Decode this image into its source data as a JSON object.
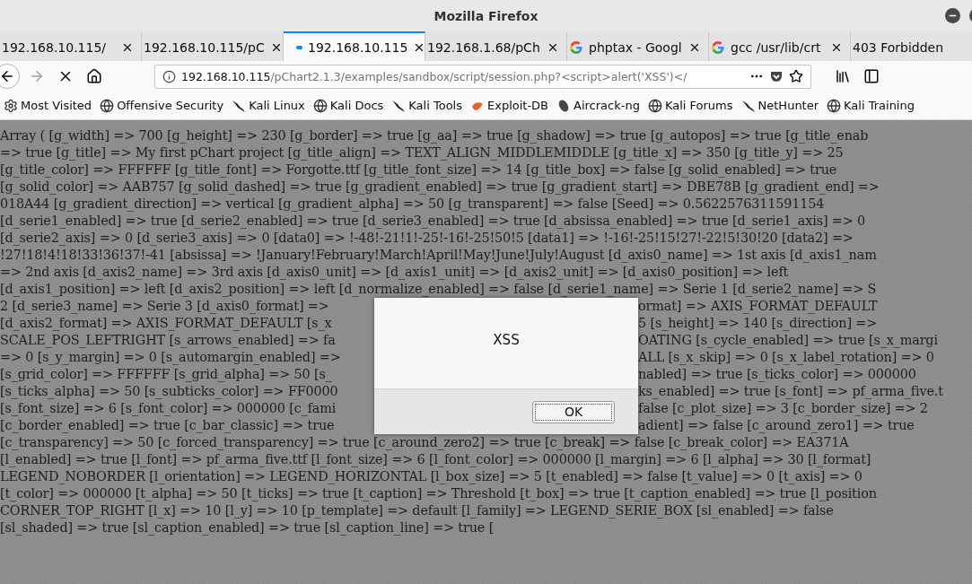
{
  "window": {
    "title": "Mozilla Firefox"
  },
  "tabs": [
    {
      "label": "192.168.10.115/",
      "selected": false,
      "loading": false,
      "kind": "plain"
    },
    {
      "label": "192.168.10.115/pC",
      "selected": false,
      "loading": false,
      "kind": "plain"
    },
    {
      "label": "192.168.10.115",
      "selected": true,
      "loading": true,
      "kind": "plain"
    },
    {
      "label": "192.168.1.68/pCh",
      "selected": false,
      "loading": false,
      "kind": "plain"
    },
    {
      "label": "phptax - Googl",
      "selected": false,
      "loading": false,
      "kind": "google"
    },
    {
      "label": "gcc /usr/lib/crt",
      "selected": false,
      "loading": false,
      "kind": "google"
    },
    {
      "label": "403 Forbidden",
      "selected": false,
      "loading": false,
      "kind": "plain"
    }
  ],
  "address": {
    "host": "192.168.10.115",
    "path": "/pChart2.1.3/examples/sandbox/script/session.php?<script>alert('XSS')</"
  },
  "bookmarks": [
    {
      "label": "Most Visited",
      "kind": "gear"
    },
    {
      "label": "Offensive Security",
      "kind": "globe"
    },
    {
      "label": "Kali Linux",
      "kind": "kali"
    },
    {
      "label": "Kali Docs",
      "kind": "globe"
    },
    {
      "label": "Kali Tools",
      "kind": "kali"
    },
    {
      "label": "Exploit-DB",
      "kind": "exploit"
    },
    {
      "label": "Aircrack-ng",
      "kind": "aircrack"
    },
    {
      "label": "Kali Forums",
      "kind": "globe"
    },
    {
      "label": "NetHunter",
      "kind": "kali"
    },
    {
      "label": "Kali Training",
      "kind": "globe"
    }
  ],
  "page": {
    "lines": [
      {
        "text": "Array ( [g_width] => 700 [g_height] => 230 [g_border] => true [g_aa] => true [g_shadow] => true [g_autopos] => true [g_title_enab"
      },
      {
        "text": "=> true [g_title] => My first pChart project [g_title_align] => TEXT_ALIGN_MIDDLEMIDDLE [g_title_x] => 350 [g_title_y] => 25"
      },
      {
        "text": "[g_title_color] => FFFFFF [g_title_font] => Forgotte.ttf [g_title_font_size] => 14 [g_title_box] => false [g_solid_enabled] => true"
      },
      {
        "text": "[g_solid_color] => AAB757 [g_solid_dashed] => true [g_gradient_enabled] => true [g_gradient_start] => DBE78B [g_gradient_end] =>"
      },
      {
        "text": "018A44 [g_gradient_direction] => vertical [g_gradient_alpha] => 50 [g_transparent] => false [Seed] => 0.5622576311591154"
      },
      {
        "text": "[d_serie1_enabled] => true [d_serie2_enabled] => true [d_serie3_enabled] => true [d_absissa_enabled] => true [d_serie1_axis] => 0"
      },
      {
        "text": "[d_serie2_axis] => 0 [d_serie3_axis] => 0 [data0] => !-48!-21!1!-25!-16!-25!50!5 [data1] => !-16!-25!15!27!-22!5!30!20 [data2] =>"
      },
      {
        "text": "!27!18!4!18!33!36!37!-41 [absissa] => !January!February!March!April!May!June!July!August [d_axis0_name] => 1st axis [d_axis1_nam"
      },
      {
        "text": "=> 2nd axis [d_axis2_name] => 3rd axis [d_axis0_unit] => [d_axis1_unit] => [d_axis2_unit] => [d_axis0_position] => left"
      },
      {
        "text": "[d_axis1_position] => left [d_axis2_position] => left [d_normalize_enabled] => false [d_serie1_name] => Serie 1 [d_serie2_name] => S"
      },
      {
        "left": "2 [d_serie3_name] => Serie 3 [d_axis0_format] =>",
        "right": "ormat] => AXIS_FORMAT_DEFAULT"
      },
      {
        "left": "[d_axis2_format] => AXIS_FORMAT_DEFAULT [s_x",
        "right": "5 [s_height] => 140 [s_direction] =>"
      },
      {
        "left": "SCALE_POS_LEFTRIGHT [s_arrows_enabled] => fa",
        "right": "OATING [s_cycle_enabled] => true [s_x_margi"
      },
      {
        "left": "=> 0 [s_y_margin] => 0 [s_automargin_enabled] =>",
        "right": "ALL [s_x_skip] => 0 [s_x_label_rotation] => 0"
      },
      {
        "left": "[s_grid_color] => FFFFFF [s_grid_alpha] => 50 [s_",
        "right": "nabled] => true [s_ticks_color] => 000000"
      },
      {
        "left": "[s_ticks_alpha] => 50 [s_subticks_color] => FF0000",
        "right": "ks_enabled] => true [s_font] => pf_arma_five.t"
      },
      {
        "left": "[s_font_size] => 6 [s_font_color] => 000000 [c_fami",
        "right": "false [c_plot_size] => 3 [c_border_size] => 2"
      },
      {
        "left": "[c_border_enabled] => true [c_bar_classic] => true",
        "right": "adient] => false [c_around_zero1] => true"
      },
      {
        "text": "[c_transparency] => 50 [c_forced_transparency] => true [c_around_zero2] => true [c_break] => false [c_break_color] => EA371A"
      },
      {
        "text": "[l_enabled] => true [l_font] => pf_arma_five.ttf [l_font_size] => 6 [l_font_color] => 000000 [l_margin] => 6 [l_alpha] => 30 [l_format]"
      },
      {
        "text": "LEGEND_NOBORDER [l_orientation] => LEGEND_HORIZONTAL [l_box_size] => 5 [t_enabled] => false [t_value] => 0 [t_axis] => 0"
      },
      {
        "text": "[t_color] => 000000 [t_alpha] => 50 [t_ticks] => true [t_caption] => Threshold [t_box] => true [t_caption_enabled] => true [l_position"
      },
      {
        "text": "CORNER_TOP_RIGHT [l_x] => 10 [l_y] => 10 [p_template] => default [l_family] => LEGEND_SERIE_BOX [sl_enabled] => false"
      },
      {
        "text": "[sl_shaded] => true [sl_caption_enabled] => true [sl_caption_line] => true ["
      }
    ]
  },
  "dialog": {
    "message": "XSS",
    "button": "OK"
  }
}
